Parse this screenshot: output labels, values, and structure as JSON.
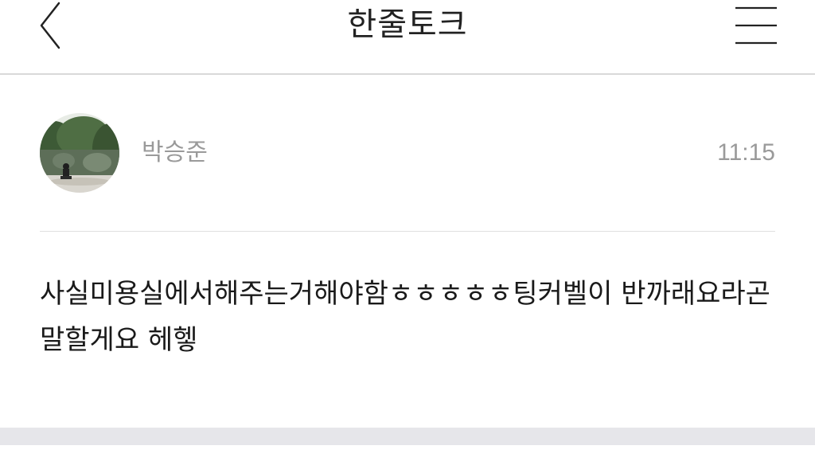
{
  "header": {
    "title": "한줄토크",
    "back_icon": "chevron-left-icon",
    "menu_icon": "hamburger-menu-icon"
  },
  "post": {
    "author": "박승준",
    "time": "11:15",
    "avatar_icon": "profile-photo-avatar",
    "body": "사실미용실에서해주는거해야함ㅎㅎㅎㅎㅎ팅커벨이 반까래요라곤 말할게요 헤헿"
  },
  "colors": {
    "header_divider": "#d9d9d9",
    "meta_text": "#9a9a9a",
    "body_text": "#1a1a1a",
    "footer_band": "#e6e6ea"
  }
}
